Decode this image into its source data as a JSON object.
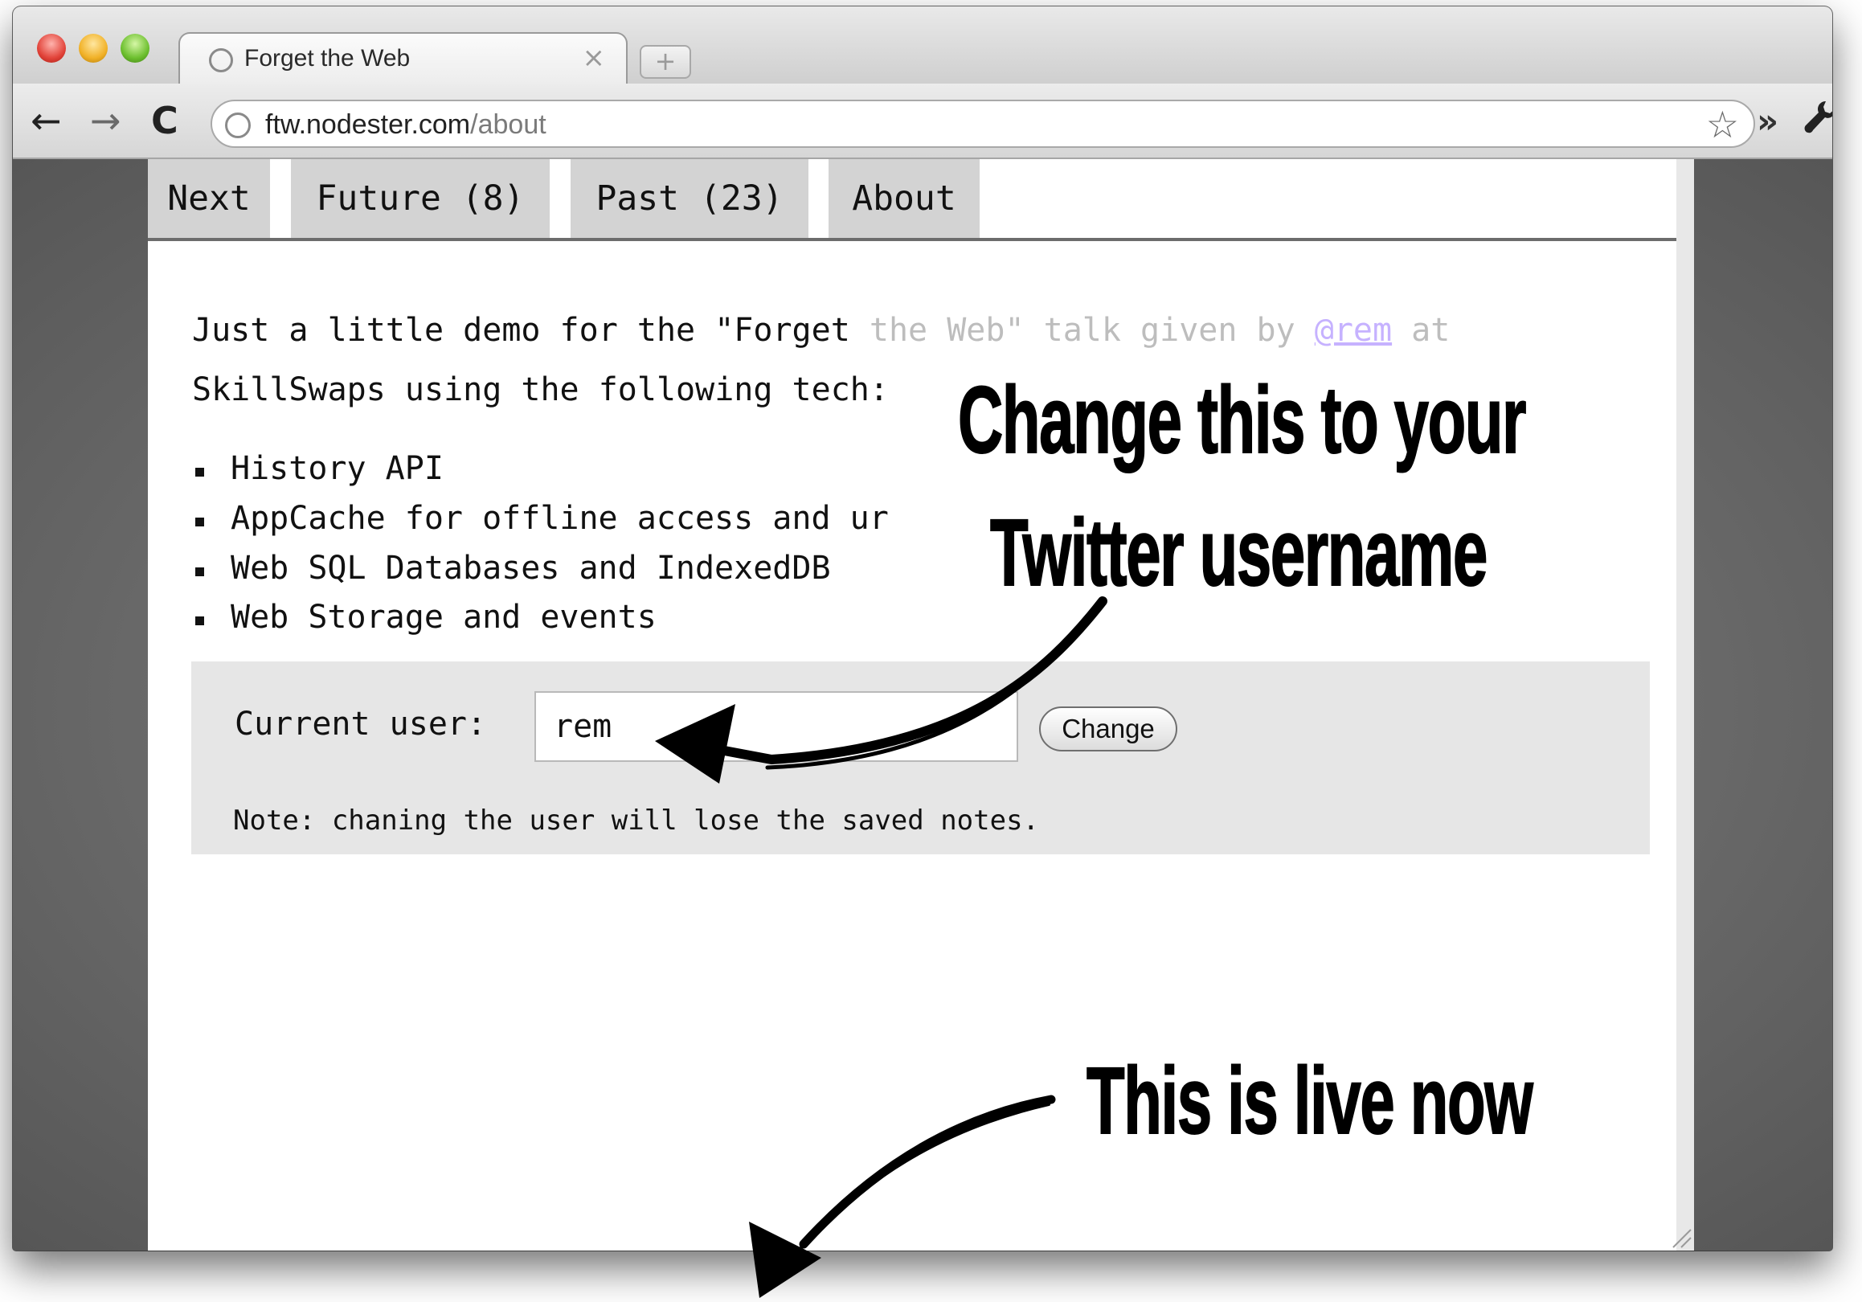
{
  "browser": {
    "tab_title": "Forget the Web",
    "tab_close": "×",
    "new_tab": "+",
    "back": "←",
    "forward": "→",
    "reload": "C",
    "url_host": "ftw.nodester.com",
    "url_path": "/about",
    "bookmark_star": "☆",
    "more": "»",
    "wrench": "🔧"
  },
  "nav": {
    "items": [
      {
        "label": "Next"
      },
      {
        "label": "Future (8)"
      },
      {
        "label": "Past (23)"
      },
      {
        "label": "About"
      }
    ]
  },
  "content": {
    "intro_line1_a": "Just a little demo for the \"Forget ",
    "intro_line1_b": "the Web\" talk given by ",
    "intro_link": "@rem",
    "intro_line1_c": " at",
    "intro_line2": "SkillSwaps using the following tech:",
    "bullets": [
      "History API",
      "AppCache for offline access and ur",
      "Web SQL Databases and IndexedDB",
      "Web Storage and events"
    ],
    "user_label": "Current user:",
    "user_value": "rem",
    "change_button": "Change",
    "note": "Note: chaning the user will lose the saved notes."
  },
  "annotations": {
    "line1": "Change this to your",
    "line2": "Twitter username",
    "live": "This is live now"
  }
}
